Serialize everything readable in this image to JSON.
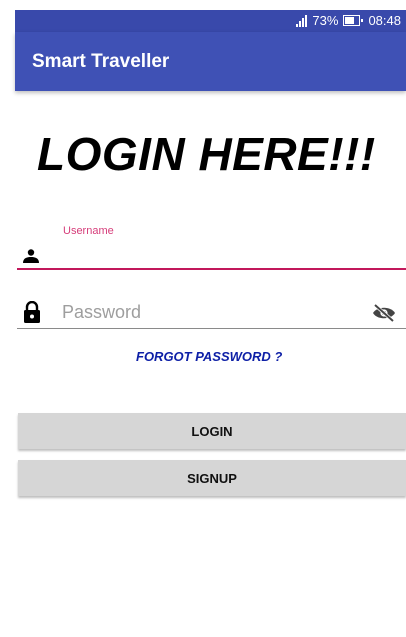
{
  "status_bar": {
    "battery_percent": "73%",
    "time": "08:48"
  },
  "app_bar": {
    "title": "Smart Traveller",
    "color": "#3f51b5"
  },
  "heading": "LOGIN HERE!!!",
  "username_field": {
    "label": "Username",
    "value": "",
    "icon": "person-icon",
    "accent_color": "#c2185b"
  },
  "password_field": {
    "placeholder": "Password",
    "value": "",
    "icon": "lock-icon",
    "toggle_icon": "eye-off-icon"
  },
  "forgot_password": "FORGOT PASSWORD ?",
  "buttons": {
    "login": "LOGIN",
    "signup": "SIGNUP"
  }
}
